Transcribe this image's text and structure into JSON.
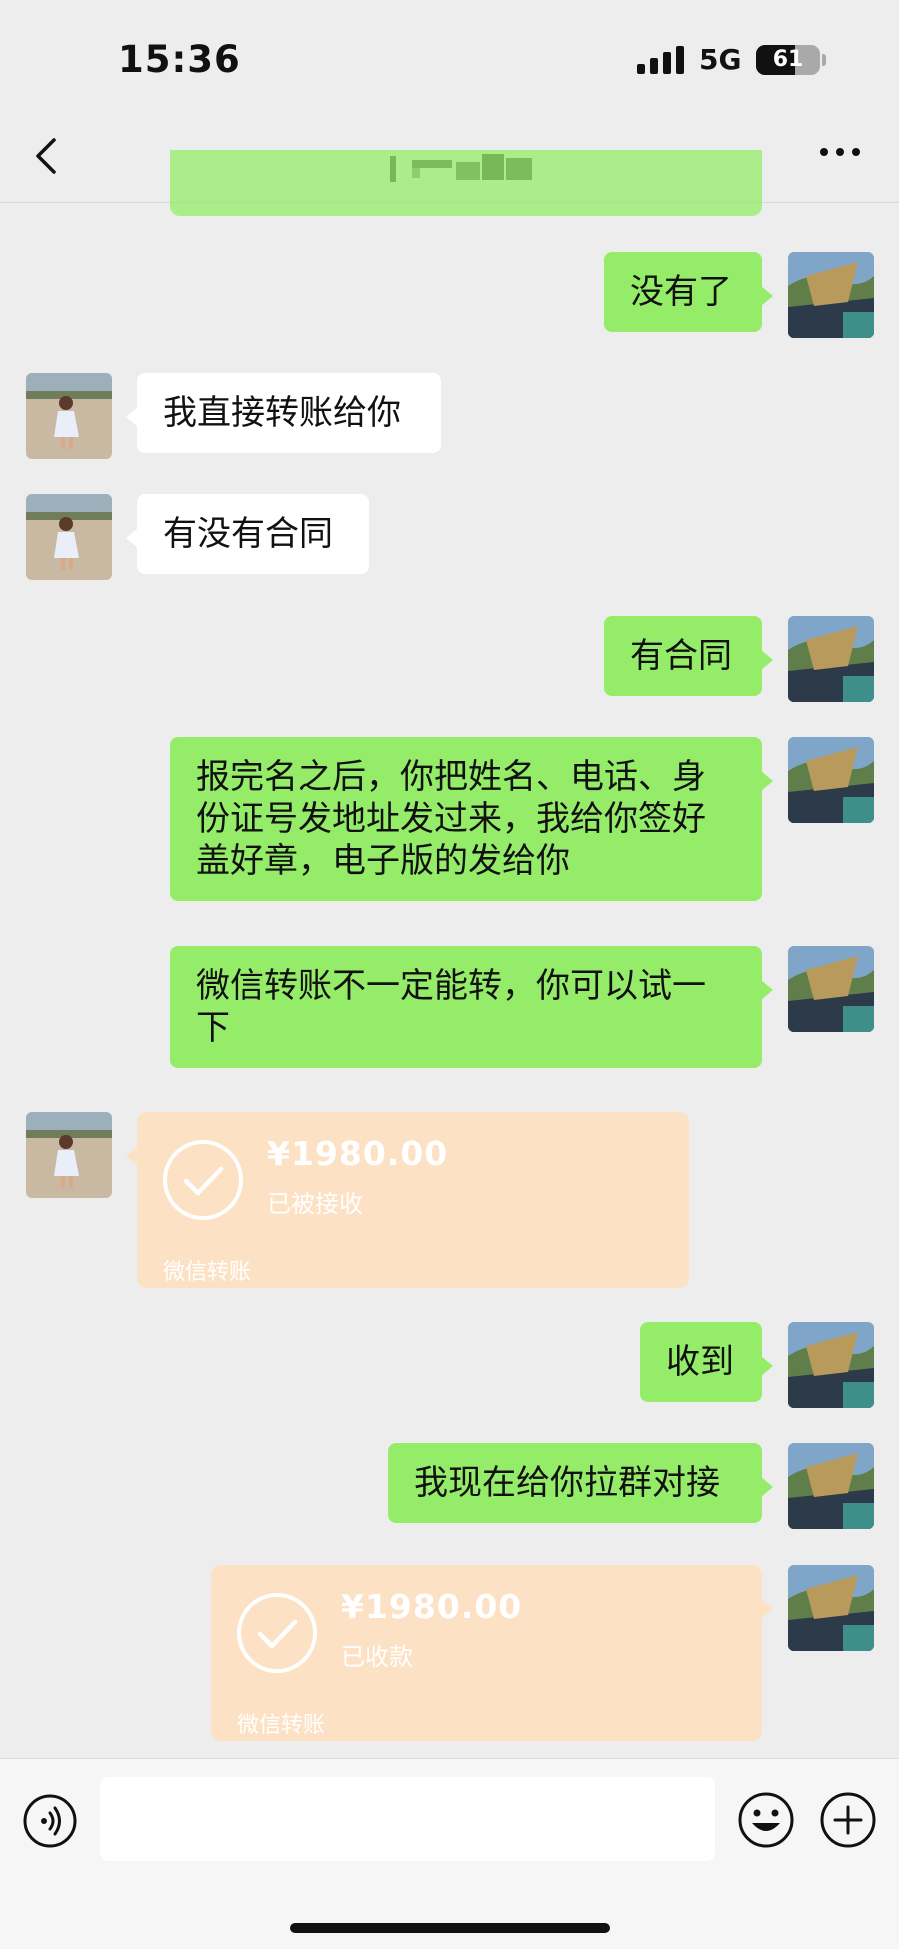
{
  "status_bar": {
    "time": "15:36",
    "network": "5G",
    "battery": "61",
    "battery_level": 0.61
  },
  "nav": {
    "title": "",
    "back_icon": "chevron-left-icon",
    "more_icon": "more-dots-icon"
  },
  "messages": [
    {
      "side": "right",
      "text": "没有了"
    },
    {
      "side": "left",
      "text": "我直接转账给你"
    },
    {
      "side": "left",
      "text": "有没有合同"
    },
    {
      "side": "right",
      "text": "有合同"
    },
    {
      "side": "right",
      "text": "报完名之后，你把姓名、电话、身份证号发地址发过来，我给你签好盖好章，电子版的发给你"
    },
    {
      "side": "right",
      "text": "微信转账不一定能转，你可以试一下"
    },
    {
      "side": "left",
      "type": "transfer",
      "amount": "¥1980.00",
      "status": "已被接收",
      "label": "微信转账"
    },
    {
      "side": "right",
      "text": "收到"
    },
    {
      "side": "right",
      "text": "我现在给你拉群对接"
    },
    {
      "side": "right",
      "type": "transfer",
      "amount": "¥1980.00",
      "status": "已收款",
      "label": "微信转账"
    }
  ],
  "input_bar": {
    "placeholder": "",
    "voice_icon": "voice-icon",
    "emoji_icon": "emoji-icon",
    "plus_icon": "plus-icon"
  },
  "colors": {
    "background": "#ededed",
    "outgoing_bubble": "#95ec69",
    "incoming_bubble": "#ffffff",
    "transfer_card": "#fde1c4"
  }
}
